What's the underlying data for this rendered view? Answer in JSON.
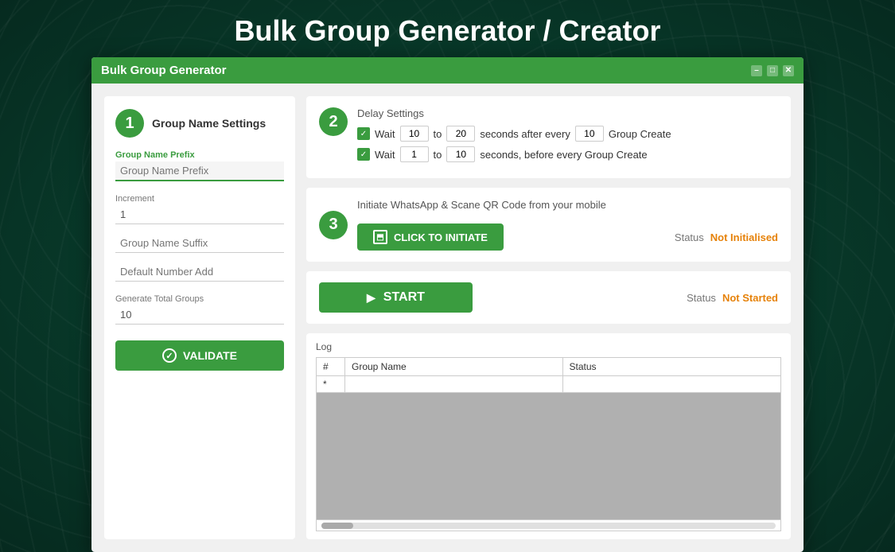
{
  "page": {
    "title": "Bulk Group Generator / Creator",
    "window_title": "Bulk Group Generator"
  },
  "titlebar": {
    "minimize": "–",
    "maximize": "□",
    "close": "✕"
  },
  "step1": {
    "number": "1",
    "title": "Group Name Settings",
    "prefix_label": "Group Name Prefix",
    "prefix_value": "",
    "increment_label": "Increment",
    "increment_value": "1",
    "suffix_placeholder": "Group Name Suffix",
    "default_number_placeholder": "Default Number Add",
    "total_label": "Generate Total Groups",
    "total_value": "10",
    "validate_label": "VALIDATE"
  },
  "step2": {
    "number": "2",
    "title": "Delay Settings",
    "row1": {
      "checked": true,
      "label_before": "Wait",
      "from": "10",
      "to_label": "to",
      "to": "20",
      "suffix": "seconds after every",
      "every": "10",
      "end": "Group Create"
    },
    "row2": {
      "checked": true,
      "label_before": "Wait",
      "from": "1",
      "to_label": "to",
      "to": "10",
      "suffix": "seconds, before every Group Create"
    }
  },
  "step3": {
    "number": "3",
    "title": "Initiate WhatsApp & Scane QR Code from your mobile",
    "initiate_label": "CLICK TO INITIATE",
    "status_label": "Status",
    "status_value": "Not Initialised"
  },
  "start": {
    "label": "START",
    "status_label": "Status",
    "status_value": "Not Started"
  },
  "log": {
    "label": "Log",
    "col_num": "#",
    "col_group_name": "Group Name",
    "col_status": "Status",
    "rows": [
      {
        "num": "*",
        "group_name": "",
        "status": ""
      }
    ]
  }
}
